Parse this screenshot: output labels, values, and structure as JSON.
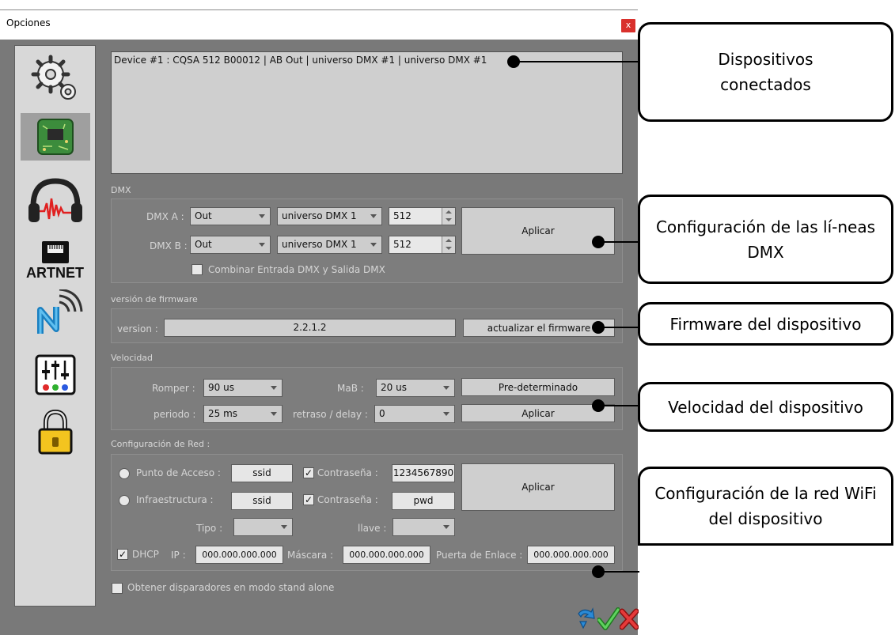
{
  "window": {
    "title": "Opciones",
    "close_label": "x"
  },
  "sidebar": {
    "items": [
      {
        "name": "settings-icon"
      },
      {
        "name": "chip-board-icon"
      },
      {
        "name": "headphones-icon"
      },
      {
        "name": "artnet-icon",
        "label": "ARTNET"
      },
      {
        "name": "wifi-n-icon"
      },
      {
        "name": "mixer-icon"
      },
      {
        "name": "lock-icon"
      }
    ]
  },
  "devices": {
    "items": [
      "Device #1 : CQSA 512 B00012 | AB Out | universo DMX #1 | universo DMX #1"
    ]
  },
  "dmx": {
    "section_label": "DMX",
    "line_a": {
      "label": "DMX A :",
      "mode": "Out",
      "universe": "universo DMX 1",
      "channels": "512"
    },
    "line_b": {
      "label": "DMX B :",
      "mode": "Out",
      "universe": "universo DMX 1",
      "channels": "512"
    },
    "combine_label": "Combinar Entrada DMX y Salida DMX",
    "combine_checked": false,
    "apply_label": "Aplicar"
  },
  "firmware": {
    "section_label": "versión de firmware",
    "version_label": "version :",
    "version_value": "2.2.1.2",
    "update_label": "actualizar el firmware"
  },
  "speed": {
    "section_label": "Velocidad",
    "break_label": "Romper :",
    "break_value": "90 us",
    "mab_label": "MaB :",
    "mab_value": "20 us",
    "default_label": "Pre-determinado",
    "period_label": "periodo :",
    "period_value": "25 ms",
    "delay_label": "retraso / delay :",
    "delay_value": "0",
    "apply_label": "Aplicar"
  },
  "network": {
    "section_label": "Configuración de Red :",
    "ap_label": "Punto de Acceso :",
    "ap_ssid": "ssid",
    "ap_pass_label": "Contraseña :",
    "ap_pass": "1234567890",
    "infra_label": "Infraestructura :",
    "infra_ssid": "ssid",
    "infra_pass_label": "Contraseña :",
    "infra_pass": "pwd",
    "type_label": "Tipo :",
    "type_value": "",
    "key_label": "llave :",
    "key_value": "",
    "dhcp_label": "DHCP",
    "dhcp_checked": true,
    "ip_label": "IP :",
    "ip_value": "000.000.000.000",
    "mask_label": "Máscara :",
    "mask_value": "000.000.000.000",
    "gateway_label": "Puerta de Enlace :",
    "gateway_value": "000.000.000.000",
    "apply_label": "Aplicar",
    "check_mark": "✓"
  },
  "standalone": {
    "label": "Obtener disparadores en modo stand alone",
    "checked": false
  },
  "footer": {
    "icons": [
      "refresh-arrow-icon",
      "ok-check-icon",
      "cancel-x-icon"
    ]
  },
  "callouts": {
    "devices": "Dispositivos conectados",
    "dmx_lines": "Configuración de las lí-neas DMX",
    "firmware": "Firmware del dispositivo",
    "speed": "Velocidad del dispositivo",
    "wifi": "Configuración de la red WiFi del dispositivo"
  },
  "colors": {
    "client_bg": "#797979",
    "sidebar_bg": "#d8d8d8",
    "close_red": "#d9302c",
    "callout_border": "#000000"
  }
}
